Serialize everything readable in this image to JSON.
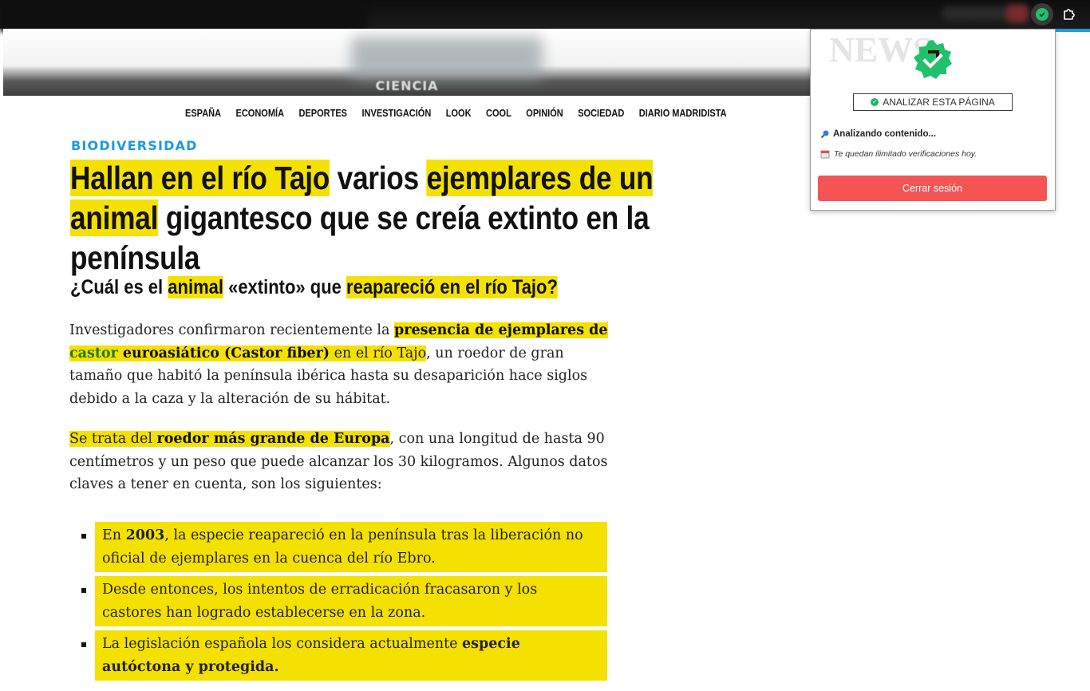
{
  "browser": {
    "active_extension_icon": "verified-check-icon",
    "extensions_icon": "puzzle-icon"
  },
  "site": {
    "section_label": "CIENCIA",
    "nav": [
      "ESPAÑA",
      "ECONOMÍA",
      "DEPORTES",
      "INVESTIGACIÓN",
      "LOOK",
      "COOL",
      "OPINIÓN",
      "SOCIEDAD",
      "DIARIO MADRIDISTA"
    ]
  },
  "article": {
    "kicker": "BIODIVERSIDAD",
    "headline": {
      "h1": "Hallan en el río Tajo",
      "t1": " varios ",
      "h2": "ejemplares de un animal",
      "t2": " gigantesco que se creía extinto en la península"
    },
    "subhead": {
      "t1": "¿Cuál es el ",
      "h1": "animal",
      "t2": " «extinto» que ",
      "h2": "reapareció en el río Tajo?"
    },
    "p1": {
      "t1": "Investigadores confirmaron recientemente la ",
      "b1": "presencia de ejemplares de",
      "g1": "castor",
      "b2": " euroasiático (Castor fiber)",
      "t2": " en el río Tajo",
      "t3": ", un roedor de gran tamaño que habitó la península ibérica hasta su desaparición hace siglos debido a la caza y la alteración de su hábitat."
    },
    "p2": {
      "t1": "Se trata del ",
      "b1": "roedor más grande de Europa",
      "t2": ", con una longitud de hasta 90 centímetros y un peso que puede alcanzar los 30 kilogramos. Algunos datos claves a tener en cuenta, son los siguientes:"
    },
    "bullets": [
      {
        "t1": "En ",
        "b1": "2003",
        "t2": ", la especie reapareció en la península tras la liberación no oficial de ejemplares en la cuenca del río Ebro."
      },
      {
        "t1": "Desde entonces, los intentos de erradicación fracasaron y los castores han logrado establecerse en la zona.",
        "b1": "",
        "t2": ""
      },
      {
        "t1": "La legislación española los considera actualmente ",
        "b1": "especie autóctona y protegida.",
        "t2": ""
      }
    ]
  },
  "popup": {
    "analyze_label": "ANALIZAR ESTA PÁGINA",
    "status": "Analizando contenido...",
    "quota": "Te quedan ilimitado verificaciones hoy.",
    "logout_label": "Cerrar sesión",
    "brand_color": "#22c06a",
    "logout_color": "#f45454"
  }
}
